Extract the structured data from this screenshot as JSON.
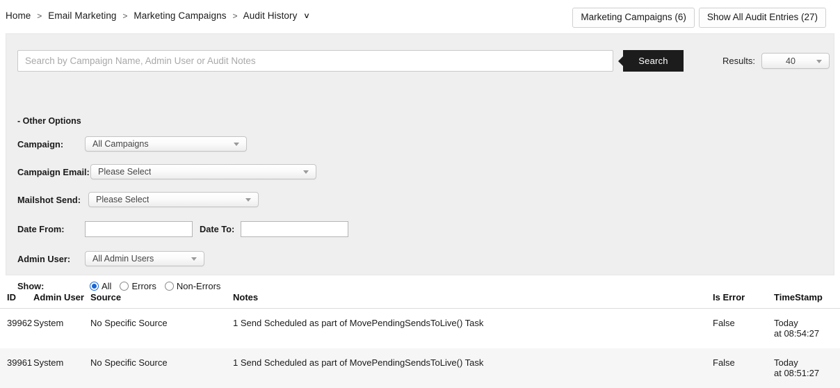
{
  "breadcrumb": {
    "items": [
      "Home",
      "Email Marketing",
      "Marketing Campaigns",
      "Audit History"
    ],
    "separator": ">",
    "caret": "∨"
  },
  "header_buttons": [
    {
      "label": "Marketing Campaigns (6)",
      "name": "marketing-campaigns-button"
    },
    {
      "label": "Show All Audit Entries (27)",
      "name": "show-all-audit-entries-button"
    }
  ],
  "search": {
    "placeholder": "Search by Campaign Name, Admin User or Audit Notes",
    "value": "",
    "button_label": "Search",
    "results_label": "Results:",
    "results_value": "40"
  },
  "filters": {
    "section_label": "- Other Options",
    "campaign": {
      "label": "Campaign:",
      "value": "All Campaigns"
    },
    "campaign_email": {
      "label": "Campaign Email:",
      "value": "Please Select"
    },
    "mailshot_send": {
      "label": "Mailshot Send:",
      "value": "Please Select"
    },
    "date_from": {
      "label": "Date From:",
      "value": ""
    },
    "date_to": {
      "label": "Date To:",
      "value": ""
    },
    "admin_user": {
      "label": "Admin User:",
      "value": "All Admin Users"
    },
    "show": {
      "label": "Show:",
      "options": [
        "All",
        "Errors",
        "Non-Errors"
      ],
      "selected": "All",
      "accent_color": "#1565d8"
    }
  },
  "table": {
    "columns": [
      "ID",
      "Admin User",
      "Source",
      "Notes",
      "Is Error",
      "TimeStamp"
    ],
    "rows": [
      {
        "id": "39962",
        "admin_user": "System",
        "source": "No Specific Source",
        "notes": "1 Send Scheduled as part of MovePendingSendsToLive() Task",
        "is_error": "False",
        "timestamp_line1": "Today",
        "timestamp_line2": "at 08:54:27"
      },
      {
        "id": "39961",
        "admin_user": "System",
        "source": "No Specific Source",
        "notes": "1 Send Scheduled as part of MovePendingSendsToLive() Task",
        "is_error": "False",
        "timestamp_line1": "Today",
        "timestamp_line2": "at 08:51:27"
      }
    ]
  }
}
